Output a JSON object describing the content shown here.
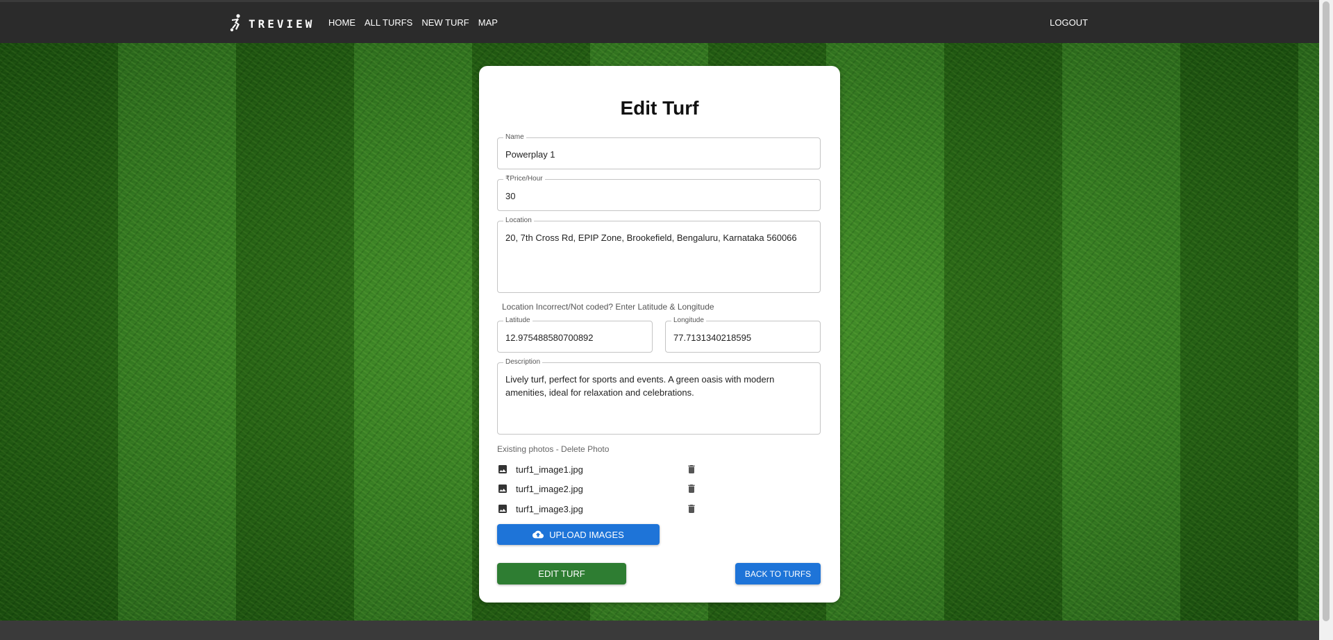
{
  "navbar": {
    "brand": "TREVIEW",
    "links": [
      "HOME",
      "ALL TURFS",
      "NEW TURF",
      "MAP"
    ],
    "logout": "LOGOUT"
  },
  "form": {
    "title": "Edit Turf",
    "name_label": "Name",
    "name_value": "Powerplay 1",
    "price_label": "₹Price/Hour",
    "price_value": "30",
    "location_label": "Location",
    "location_value": "20, 7th Cross Rd, EPIP Zone, Brookefield, Bengaluru, Karnataka 560066",
    "hint": "Location Incorrect/Not coded? Enter Latitude & Longitude",
    "latitude_label": "Latitude",
    "latitude_value": "12.975488580700892",
    "longitude_label": "Longitude",
    "longitude_value": "77.7131340218595",
    "description_label": "Description",
    "description_value": "Lively turf, perfect for sports and events. A green oasis with modern amenities, ideal for relaxation and celebrations.",
    "existing_photos_label": "Existing photos - Delete Photo",
    "photos": [
      "turf1_image1.jpg",
      "turf1_image2.jpg",
      "turf1_image3.jpg"
    ],
    "upload_label": "UPLOAD IMAGES",
    "edit_label": "EDIT TURF",
    "back_label": "BACK TO TURFS"
  },
  "colors": {
    "navbar": "#2b2b2b",
    "primary": "#1e74d8",
    "success": "#2e7d32"
  },
  "icons": [
    "player-logo-icon",
    "image-icon",
    "trash-icon",
    "cloud-upload-icon"
  ]
}
